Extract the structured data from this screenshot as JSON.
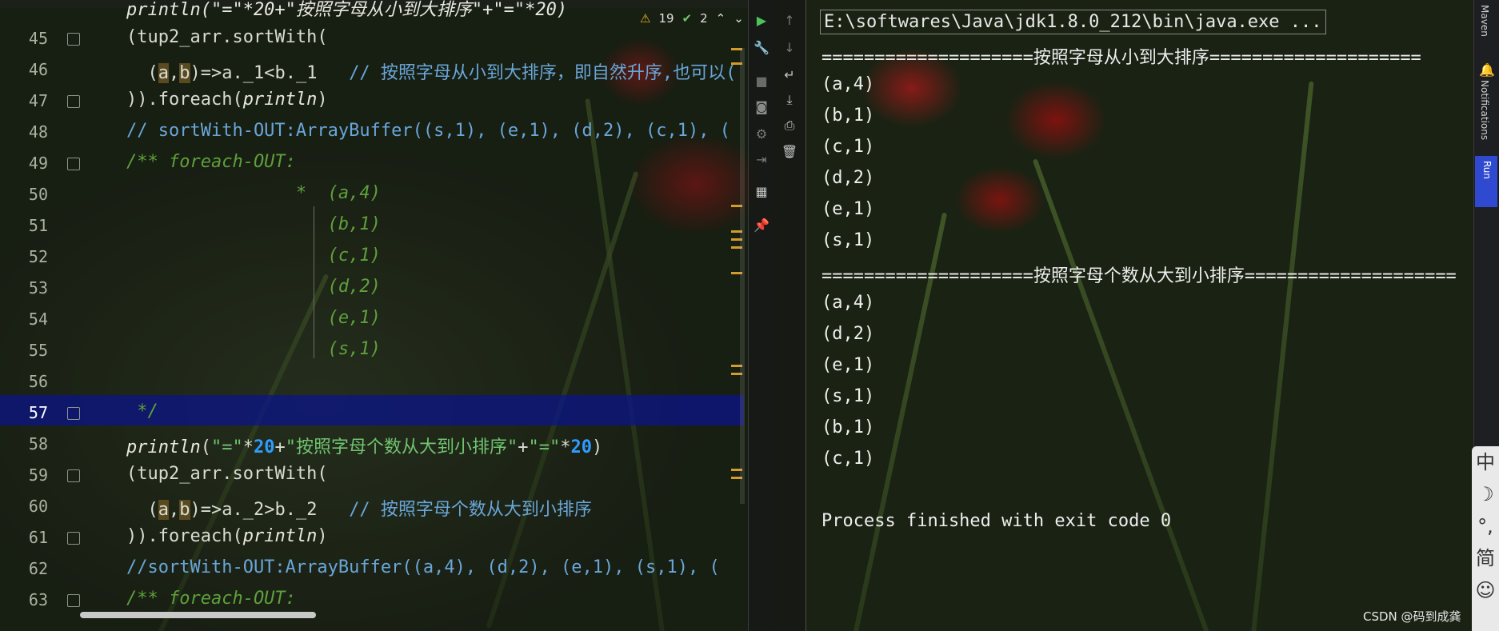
{
  "editor": {
    "inspections": {
      "warnings": "19",
      "weak_warnings": "2"
    },
    "lines": [
      {
        "num": "45"
      },
      {
        "num": "46"
      },
      {
        "num": "47"
      },
      {
        "num": "48"
      },
      {
        "num": "49"
      },
      {
        "num": "50"
      },
      {
        "num": "51"
      },
      {
        "num": "52"
      },
      {
        "num": "53"
      },
      {
        "num": "54"
      },
      {
        "num": "55"
      },
      {
        "num": "56"
      },
      {
        "num": "57"
      },
      {
        "num": "58"
      },
      {
        "num": "59"
      },
      {
        "num": "60"
      },
      {
        "num": "61"
      },
      {
        "num": "62"
      },
      {
        "num": "63"
      }
    ],
    "code": {
      "l44": "println(\"=\"*20+\"按照字母从小到大排序\"+\"=\"*20)",
      "l45": "(tup2_arr.sortWith(",
      "l46_a": "  (",
      "l46_b": "a",
      "l46_c": ",",
      "l46_d": "b",
      "l46_e": ")=>a._1<b._1   ",
      "l46_cmt": "// 按照字母从小到大排序，即自然升序,也可以(",
      "l47": ")).foreach(",
      "l47_fn": "println",
      "l47_end": ")",
      "l48": "// sortWith-OUT:ArrayBuffer((s,1), (e,1), (d,2), (c,1), (",
      "l49": "/** foreach-OUT:",
      "l50": "                *  (a,4)",
      "l51": "                   (b,1)",
      "l52": "                   (c,1)",
      "l53": "                   (d,2)",
      "l54": "                   (e,1)",
      "l55": "                   (s,1)",
      "l57": " */",
      "l58_fn": "println",
      "l58_a": "(",
      "l58_s1": "\"=\"",
      "l58_b": "*",
      "l58_n1": "20",
      "l58_c": "+",
      "l58_s2": "\"按照字母个数从大到小排序\"",
      "l58_d": "+",
      "l58_s3": "\"=\"",
      "l58_e": "*",
      "l58_n2": "20",
      "l58_f": ")",
      "l59": "(tup2_arr.sortWith(",
      "l60_a": "  (",
      "l60_b": "a",
      "l60_c": ",",
      "l60_d": "b",
      "l60_e": ")=>a._2>b._2   ",
      "l60_cmt": "// 按照字母个数从大到小排序",
      "l61": ")).foreach(",
      "l61_fn": "println",
      "l61_end": ")",
      "l62": "//sortWith-OUT:ArrayBuffer((a,4), (d,2), (e,1), (s,1), (",
      "l63": "/** foreach-OUT:"
    }
  },
  "run_toolbar": {
    "icons": [
      "run-icon",
      "wrench-icon",
      "stop-icon",
      "camera-icon",
      "settings-icon",
      "exit-icon",
      "layout-icon",
      "pin-icon",
      "up-arrow-icon",
      "down-arrow-icon",
      "soft-wrap-icon",
      "scroll-to-end-icon",
      "print-icon",
      "trash-icon"
    ]
  },
  "console": {
    "command": "E:\\softwares\\Java\\jdk1.8.0_212\\bin\\java.exe ...",
    "output": [
      "====================按照字母从小到大排序====================",
      "(a,4)",
      "(b,1)",
      "(c,1)",
      "(d,2)",
      "(e,1)",
      "(s,1)",
      "====================按照字母个数从大到小排序====================",
      "(a,4)",
      "(d,2)",
      "(e,1)",
      "(s,1)",
      "(b,1)",
      "(c,1)",
      "",
      "Process finished with exit code 0"
    ]
  },
  "right_strip": {
    "maven": "Maven",
    "notifications": "Notifications",
    "run": "Run"
  },
  "ime": [
    "中",
    "☽",
    "°,",
    "简",
    "☺"
  ],
  "watermark": "CSDN @码到成龚"
}
